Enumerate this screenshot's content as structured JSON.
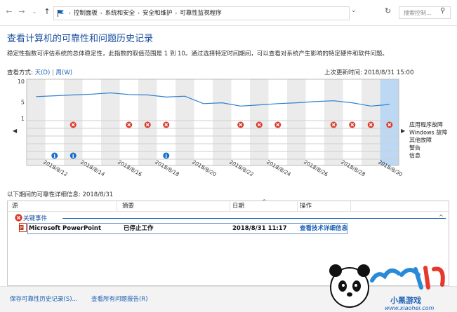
{
  "address": {
    "crumbs": [
      "控制面板",
      "系统和安全",
      "安全和维护",
      "可靠性监视程序"
    ],
    "search_placeholder": "搜索控制..."
  },
  "page": {
    "title": "查看计算机的可靠性和问题历史记录",
    "description": "稳定性指数可评估系统的总体稳定性，此指数的取值范围是 1 到 10。通过选择特定时间期间，可以查看对系统产生影响的特定硬件和软件问题。",
    "view_by_label": "查看方式:",
    "view_day": "天(D)",
    "view_week": "周(W)",
    "last_updated": "上次更新时间: 2018/8/31 15:00"
  },
  "chart_data": {
    "type": "line",
    "y_ticks": [
      "10",
      "5",
      "1"
    ],
    "ylim": [
      1,
      10
    ],
    "x_labels": [
      "2018/8/12",
      "2018/8/14",
      "2018/8/16",
      "2018/8/18",
      "2018/8/20",
      "2018/8/22",
      "2018/8/24",
      "2018/8/26",
      "2018/8/28",
      "2018/8/30"
    ],
    "days": 20,
    "selected_day_index": 19,
    "stability_index": [
      6.3,
      6.5,
      6.7,
      6.9,
      7.2,
      6.8,
      6.7,
      6.2,
      6.4,
      4.6,
      4.8,
      4.0,
      4.3,
      4.6,
      4.8,
      5.1,
      5.3,
      4.8,
      4.0,
      4.4
    ],
    "row_labels": [
      "应用程序故障",
      "Windows 故障",
      "其他故障",
      "警告",
      "信息"
    ],
    "app_failure_days": [
      2,
      5,
      6,
      7,
      11,
      12,
      13,
      16,
      17,
      18,
      19
    ],
    "info_days": [
      1,
      2,
      7
    ]
  },
  "details": {
    "title": "以下期间的可靠性详细信息: 2018/8/31",
    "columns": [
      "源",
      "摘要",
      "日期",
      "操作"
    ],
    "group_label": "关键事件",
    "row": {
      "source": "Microsoft PowerPoint",
      "summary": "已停止工作",
      "date": "2018/8/31 11:17",
      "action": "查看技术详细信息"
    }
  },
  "footer": {
    "save_link": "保存可靠性历史记录(S)...",
    "view_all_link": "查看所有问题报告(R)"
  },
  "watermark": {
    "text": "小黑游戏",
    "url": "www.xiaohei.com"
  }
}
